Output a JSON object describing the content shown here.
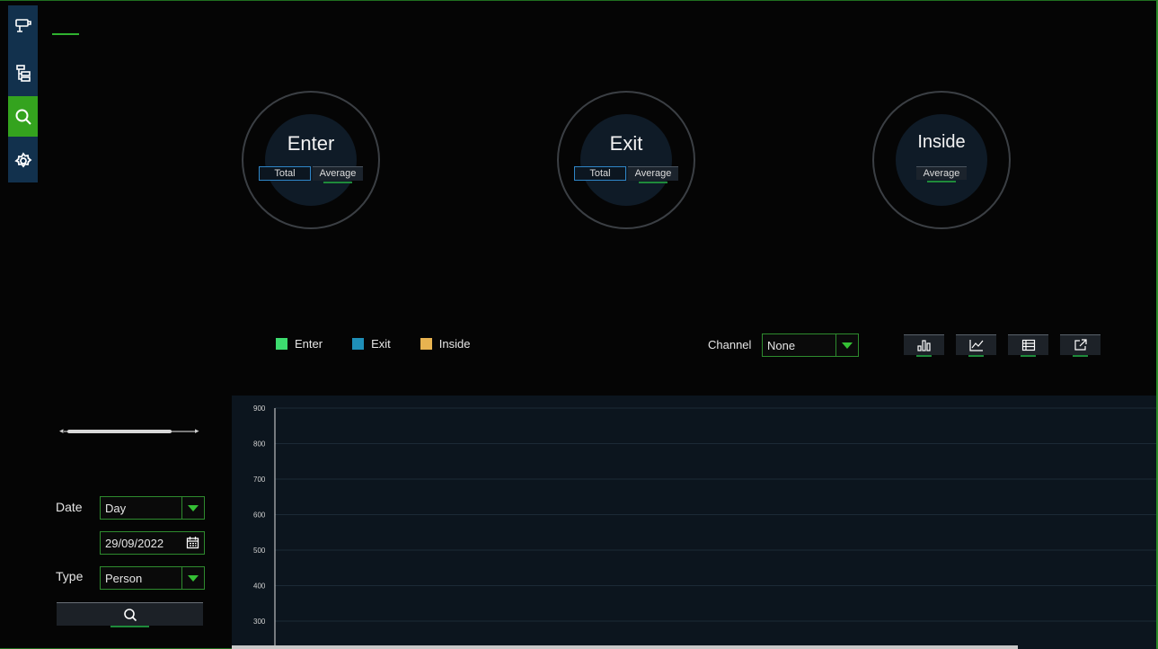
{
  "nav": {
    "items": [
      {
        "icon": "camera-icon",
        "active": false
      },
      {
        "icon": "device-tree-icon",
        "active": false
      },
      {
        "icon": "search-icon",
        "active": true
      },
      {
        "icon": "gear-icon",
        "active": false
      }
    ]
  },
  "stats": {
    "enter": {
      "title": "Enter",
      "total_label": "Total",
      "average_label": "Average"
    },
    "exit": {
      "title": "Exit",
      "total_label": "Total",
      "average_label": "Average"
    },
    "inside": {
      "title": "Inside",
      "average_label": "Average"
    }
  },
  "legend": [
    {
      "label": "Enter",
      "color": "#3ddc6f"
    },
    {
      "label": "Exit",
      "color": "#1f8fb8"
    },
    {
      "label": "Inside",
      "color": "#e8b350"
    }
  ],
  "channel": {
    "label": "Channel",
    "value": "None"
  },
  "toolbar": {
    "icons": [
      "bar-chart-icon",
      "line-chart-icon",
      "table-icon",
      "export-icon"
    ]
  },
  "filters": {
    "date_label": "Date",
    "date_mode": "Day",
    "date_value": "29/09/2022",
    "type_label": "Type",
    "type_value": "Person"
  },
  "chart_data": {
    "type": "line",
    "y_ticks": [
      "900",
      "800",
      "700",
      "600",
      "500",
      "400",
      "300"
    ],
    "ylim": [
      300,
      900
    ],
    "series": []
  },
  "colors": {
    "accent": "#34a31e",
    "nav_bg": "#12314d",
    "chart_bg": "#0c151e"
  }
}
